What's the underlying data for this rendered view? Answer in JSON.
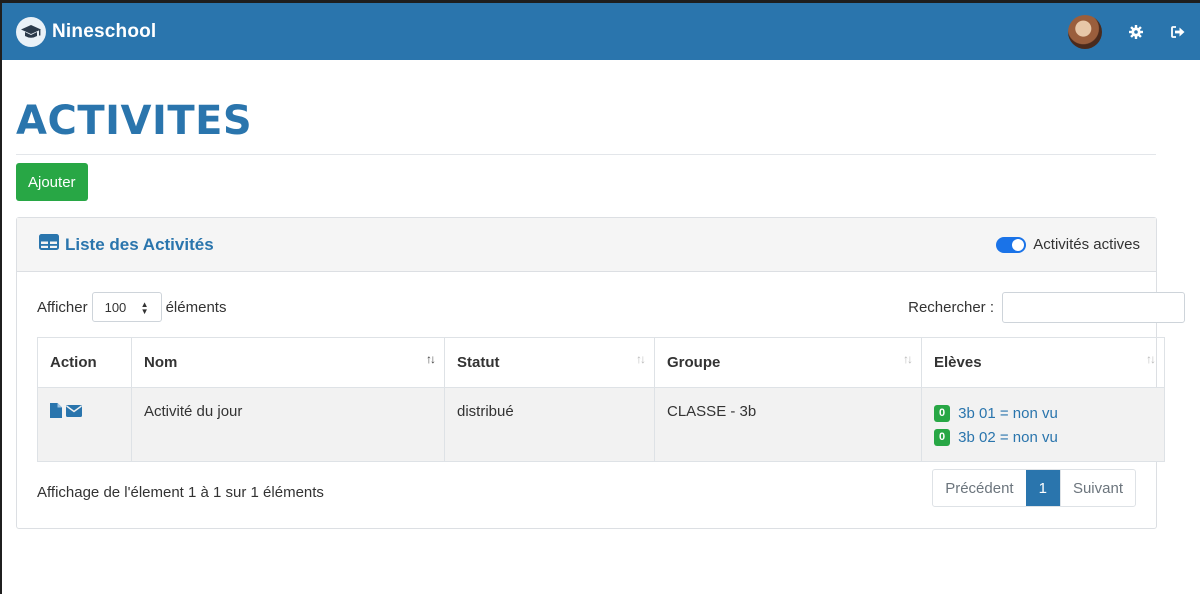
{
  "app": {
    "name": "Nineschool"
  },
  "colors": {
    "brand": "#2a75ad",
    "success": "#28a745",
    "toggle": "#1a73e8"
  },
  "icons": {
    "logo": "graduation-cap-icon",
    "settings": "gear-icon",
    "logout": "sign-out-icon",
    "card_title": "table-icon",
    "action_file": "file-icon",
    "action_mail": "envelope-icon"
  },
  "page": {
    "title": "ACTIVITES",
    "add_button": "Ajouter"
  },
  "card": {
    "title": "Liste des Activités",
    "toggle_label": "Activités actives",
    "toggle_on": true
  },
  "controls": {
    "show_prefix": "Afficher",
    "show_value": "100",
    "show_suffix": "éléments",
    "search_label": "Rechercher :",
    "search_value": ""
  },
  "table": {
    "columns": [
      "Action",
      "Nom",
      "Statut",
      "Groupe",
      "Elèves"
    ],
    "rows": [
      {
        "nom": "Activité du jour",
        "statut": "distribué",
        "groupe": "CLASSE - 3b",
        "eleves": [
          {
            "badge": "0",
            "label": "3b 01 = non vu"
          },
          {
            "badge": "0",
            "label": "3b 02 = non vu"
          }
        ]
      }
    ]
  },
  "footer": {
    "info": "Affichage de l'élement 1 à 1 sur 1 éléments",
    "prev": "Précédent",
    "page": "1",
    "next": "Suivant"
  }
}
